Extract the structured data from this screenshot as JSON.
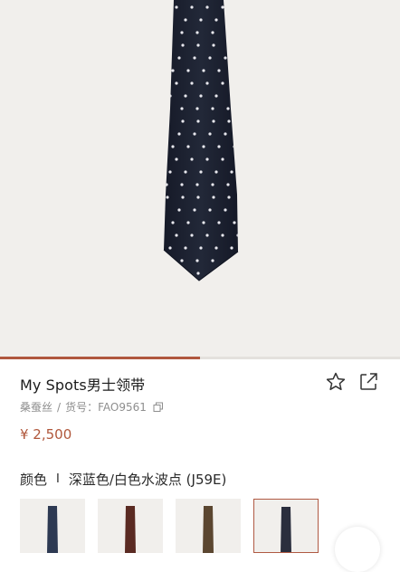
{
  "product": {
    "title": "My Spots男士领带",
    "material": "桑蚕丝",
    "meta_sep": "/",
    "sku_label": "货号：",
    "sku": "FAO9561",
    "price": "¥ 2,500"
  },
  "gallery": {
    "progress": 0.5
  },
  "color": {
    "label": "颜色",
    "divider": "I",
    "selected": "深蓝色/白色水波点 (J59E)"
  },
  "swatches": [
    {
      "tie_color": "#2d3952"
    },
    {
      "tie_color": "#5a2a22"
    },
    {
      "tie_color": "#5b4630"
    },
    {
      "tie_color": "#2a2e3d",
      "selected": true
    }
  ],
  "colors": {
    "accent": "#b0573b",
    "tie_main": "#1f2436",
    "dot": "#e8e8ee"
  },
  "icons": [
    "star-icon",
    "share-icon",
    "copy-icon",
    "next-arrow"
  ]
}
